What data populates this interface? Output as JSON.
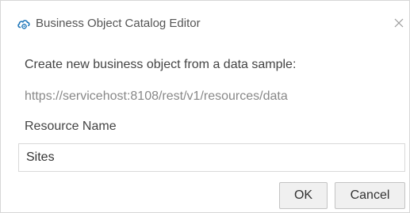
{
  "window": {
    "title": "Business Object Catalog Editor",
    "app_icon": "cloud-gear-icon",
    "close_icon": "close-icon",
    "accent_color": "#1b74b8"
  },
  "form": {
    "prompt": "Create new business object from a data sample:",
    "url": "https://servicehost:8108/rest/v1/resources/data",
    "resource_name_label": "Resource Name",
    "resource_name_value": "Sites"
  },
  "buttons": {
    "ok_label": "OK",
    "cancel_label": "Cancel"
  }
}
